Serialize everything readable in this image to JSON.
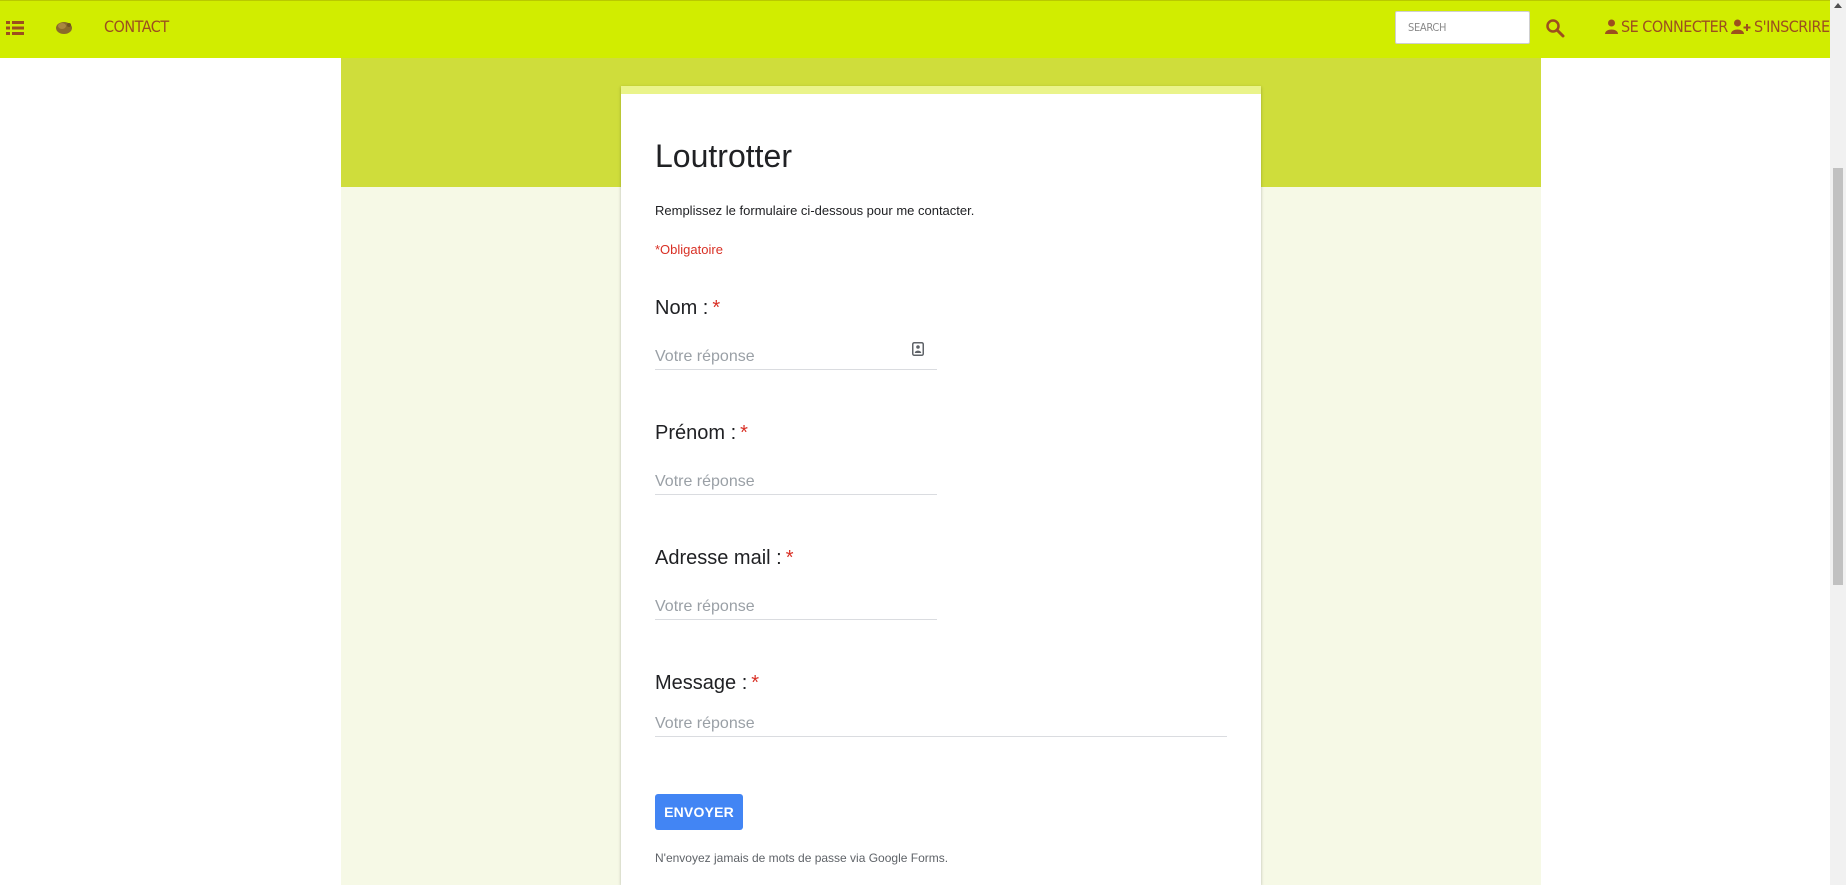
{
  "navbar": {
    "contact_label": "Contact",
    "search_placeholder": "Search",
    "login_label": "Se connecter",
    "signup_label": "S'inscrire",
    "icons": [
      "list-icon",
      "logo-icon",
      "search-icon",
      "user-icon",
      "user-plus-icon"
    ],
    "colors": {
      "background": "#d1ed00",
      "text": "#9c4f1e"
    }
  },
  "form": {
    "title": "Loutrotter",
    "description": "Remplissez le formulaire ci-dessous pour me contacter.",
    "required_note": "*Obligatoire",
    "questions": [
      {
        "label": "Nom :",
        "placeholder": "Votre réponse"
      },
      {
        "label": "Prénom :",
        "placeholder": "Votre réponse"
      },
      {
        "label": "Adresse mail :",
        "placeholder": "Votre réponse"
      },
      {
        "label": "Message :",
        "placeholder": "Votre réponse"
      }
    ],
    "required_marker": "*",
    "submit_label": "ENVOYER",
    "footer_note": "N'envoyez jamais de mots de passe via Google Forms.",
    "colors": {
      "accent": "#4285f4",
      "required": "#d93025",
      "band": "#cfdd3b",
      "body_bg": "#f6f9e6"
    }
  }
}
